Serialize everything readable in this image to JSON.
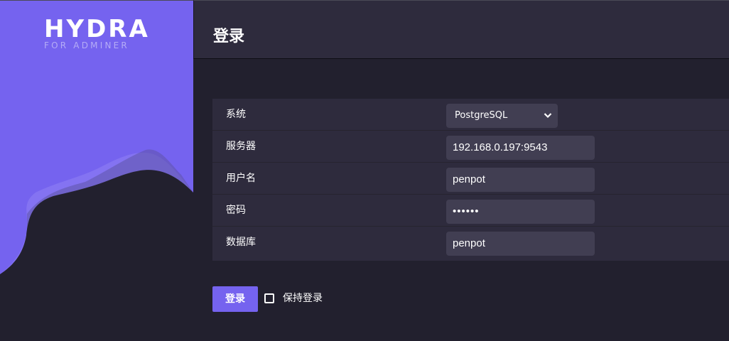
{
  "logo": {
    "title": "HYDRA",
    "subtitle": "FOR ADMINER"
  },
  "header": {
    "title": "登录"
  },
  "form": {
    "rows": [
      {
        "label": "系统",
        "value": "PostgreSQL"
      },
      {
        "label": "服务器",
        "value": "192.168.0.197:9543"
      },
      {
        "label": "用户名",
        "value": "penpot"
      },
      {
        "label": "密码",
        "value": "••••••"
      },
      {
        "label": "数据库",
        "value": "penpot"
      }
    ]
  },
  "actions": {
    "login_label": "登录",
    "remember_label": "保持登录",
    "remember_checked": false
  },
  "colors": {
    "accent": "#7563ef",
    "background": "#22202e",
    "panel": "#2e2b3d",
    "input": "#413e52"
  }
}
